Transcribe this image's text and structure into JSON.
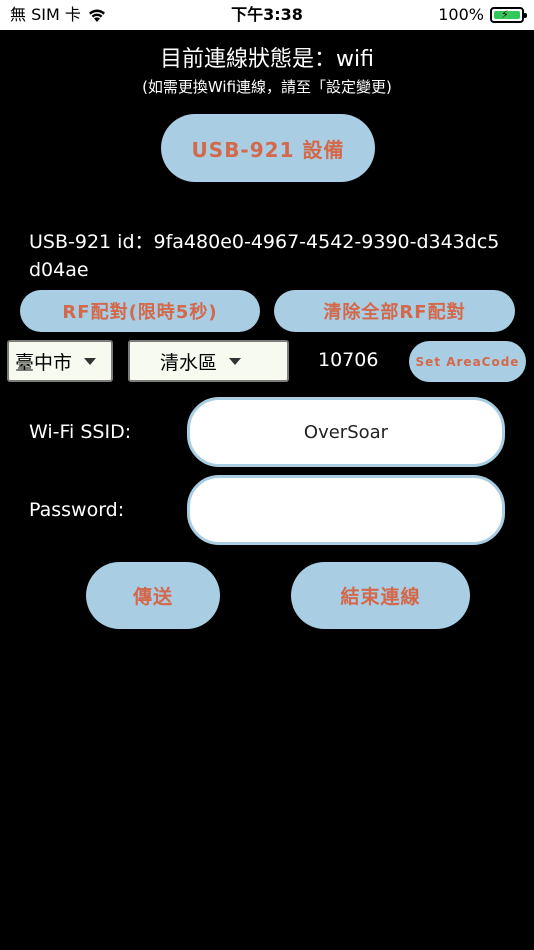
{
  "status_bar": {
    "carrier": "無 SIM 卡",
    "time": "下午3:38",
    "battery": "100%"
  },
  "header": {
    "status_text": "目前連線狀態是：wifi",
    "hint_text": "(如需更換Wifi連線，請至「設定變更)"
  },
  "device_button_label": "USB-921 設備",
  "device_id_text": "USB-921 id：9fa480e0-4967-4542-9390-d343dc5d04ae",
  "rf": {
    "pair_label": "RF配對(限時5秒)",
    "clear_label": "清除全部RF配對"
  },
  "location": {
    "city": "臺中市",
    "district": "清水區",
    "area_code": "10706",
    "set_area_code_label": "Set AreaCode"
  },
  "wifi": {
    "ssid_label": "Wi-Fi SSID:",
    "ssid_value": "OverSoar",
    "password_label": "Password:",
    "password_value": ""
  },
  "actions": {
    "send_label": "傳送",
    "end_label": "結束連線"
  },
  "colors": {
    "background": "#000000",
    "button_bg": "#a9cde3",
    "button_text": "#d4684a",
    "select_bg": "#f7fbef"
  }
}
